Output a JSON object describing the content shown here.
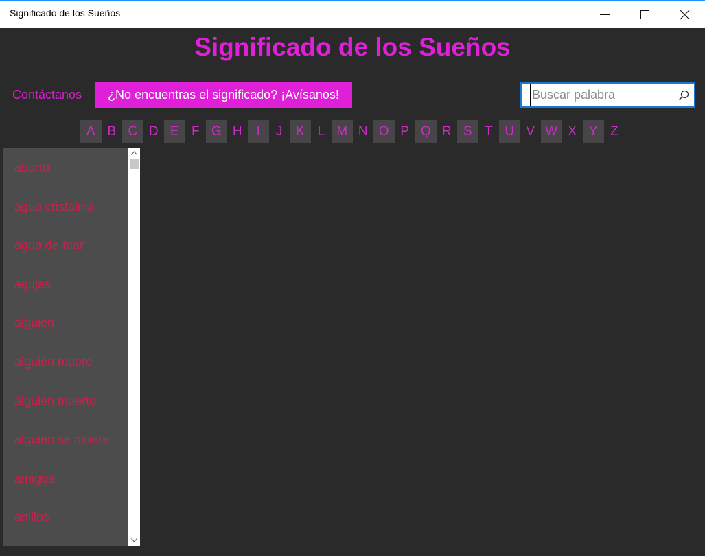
{
  "window": {
    "title": "Significado de los Sueños"
  },
  "header": {
    "app_title": "Significado de los Sueños"
  },
  "toolbar": {
    "contact_label": "Contáctanos",
    "report_label": "¿No encuentras el significado? ¡Avísanos!"
  },
  "search": {
    "placeholder": "Buscar palabra",
    "value": "",
    "icon": "search-icon"
  },
  "alphabet": [
    "A",
    "B",
    "C",
    "D",
    "E",
    "F",
    "G",
    "H",
    "I",
    "J",
    "K",
    "L",
    "M",
    "N",
    "O",
    "P",
    "Q",
    "R",
    "S",
    "T",
    "U",
    "V",
    "W",
    "X",
    "Y",
    "Z"
  ],
  "dreams": {
    "items": [
      "aborto",
      "agua cristalina",
      "agua de mar",
      "agujas",
      "alguien",
      "alguien muere",
      "alguien muerto",
      "alguien se muere",
      "amigos",
      "anillos"
    ]
  },
  "colors": {
    "accent": "#e01fd9",
    "list_text": "#cc1f4c",
    "background": "#2b2a2b",
    "panel": "#4c4c4c"
  }
}
